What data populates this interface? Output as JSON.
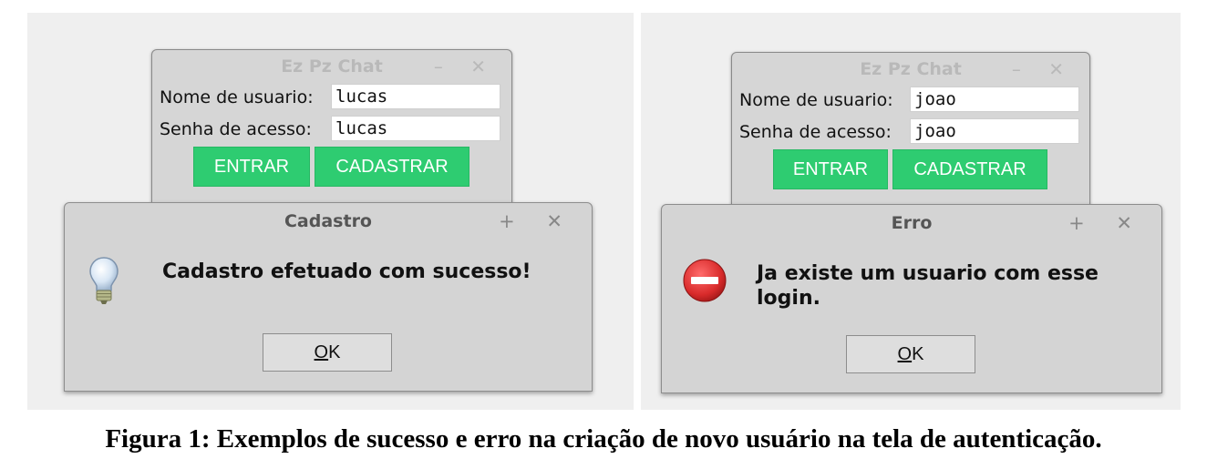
{
  "left": {
    "login": {
      "title": "Ez Pz Chat",
      "wm_buttons": "– ✕",
      "user_label": "Nome de usuario:",
      "user_value": "lucas",
      "password_label": "Senha de acesso:",
      "password_value": "lucas",
      "enter_button": "ENTRAR",
      "register_button": "CADASTRAR"
    },
    "dialog": {
      "title": "Cadastro",
      "wm_buttons": "+ ✕",
      "icon": "info-lightbulb-icon",
      "message": "Cadastro efetuado com sucesso!",
      "ok_mnemonic": "O",
      "ok_rest": "K"
    }
  },
  "right": {
    "login": {
      "title": "Ez Pz Chat",
      "wm_buttons": "– ✕",
      "user_label": "Nome de usuario:",
      "user_value": "joao",
      "password_label": "Senha de acesso:",
      "password_value": "joao",
      "enter_button": "ENTRAR",
      "register_button": "CADASTRAR"
    },
    "dialog": {
      "title": "Erro",
      "wm_buttons": "+ ✕",
      "icon": "error-stop-icon",
      "message": "Ja existe um usuario com esse login.",
      "ok_mnemonic": "O",
      "ok_rest": "K"
    }
  },
  "caption": "Figura 1: Exemplos de sucesso e erro na criação de novo usuário na tela de autenticação.",
  "colors": {
    "accent_green": "#2ecc71",
    "error_red": "#d92b2b",
    "window_gray": "#d6d6d6"
  }
}
